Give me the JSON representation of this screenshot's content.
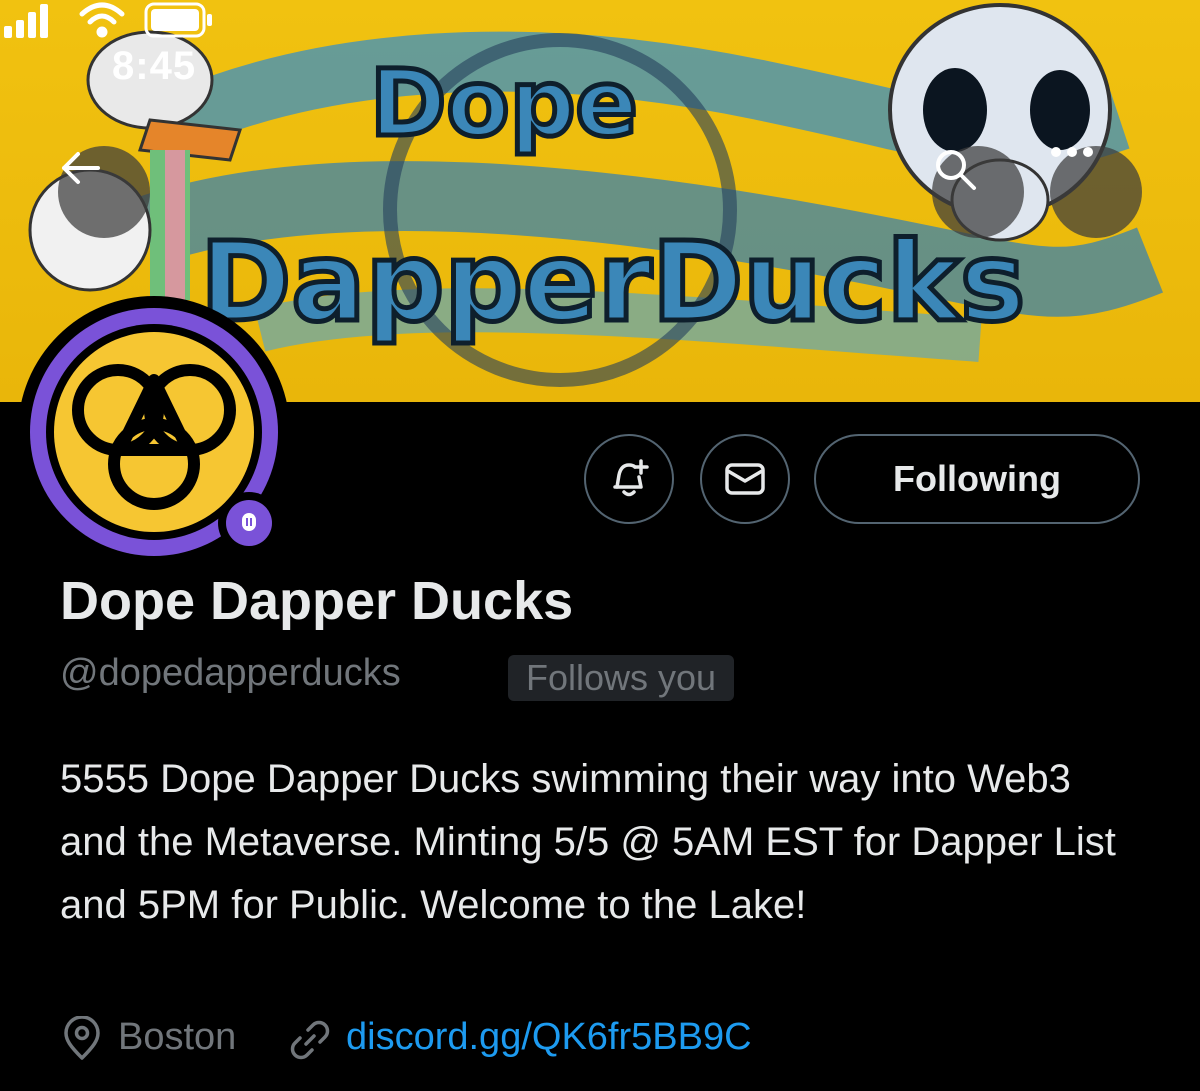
{
  "status_bar": {
    "time": "8:45"
  },
  "banner": {
    "artwork_text": "Dope DapperDucks"
  },
  "header": {
    "back_icon": "arrow-left-icon",
    "search_icon": "search-icon",
    "more_icon": "more-horizontal-icon"
  },
  "profile": {
    "name": "Dope Dapper Ducks",
    "handle": "@dopedapperducks",
    "follows_you": "Follows you",
    "bio": "5555 Dope Dapper Ducks swimming their way into Web3 and the Metaverse. Minting 5/5 @ 5AM EST for Dapper List and 5PM for Public. Welcome to the Lake!",
    "location": "Boston",
    "link": "discord.gg/QK6fr5BB9C"
  },
  "actions": {
    "notify_icon": "bell-plus-icon",
    "message_icon": "mail-icon",
    "following_label": "Following"
  },
  "colors": {
    "background": "#000000",
    "banner_yellow": "#f1c210",
    "avatar_ring": "#7a52d8",
    "link_blue": "#1d9bf0",
    "muted_text": "#71767b"
  }
}
